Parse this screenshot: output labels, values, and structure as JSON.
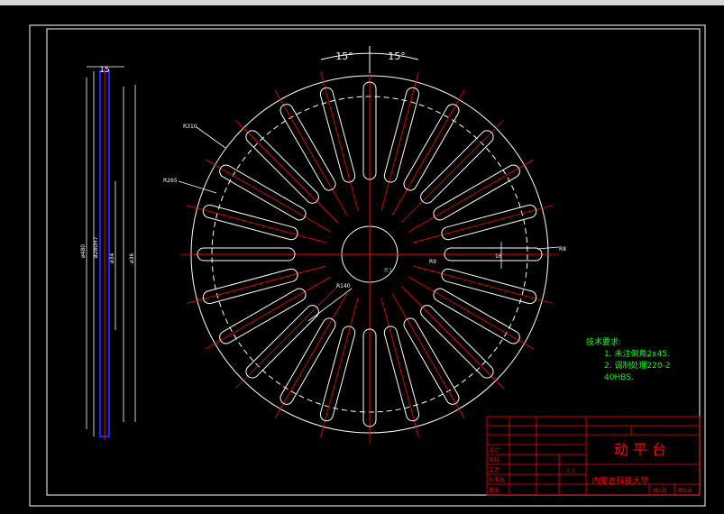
{
  "dimensions": {
    "top_angle_left": "15°",
    "top_angle_right": "15°",
    "side_thickness": "15",
    "r_outer": "R310",
    "r_ring": "R265",
    "r_inner": "R140",
    "r_hub": "R1",
    "r_slot_end": "R8",
    "r_slot": "R9",
    "slot_width": "16",
    "side_dim_1": "ø480",
    "side_dim_2": "ø280H7",
    "side_dim_3": "ø34",
    "side_dim_4": "ø36"
  },
  "note_mark": "",
  "notes": {
    "title": "技术要求:",
    "line1": "1. 未注倒角2x45.",
    "line2": "2. 调制处理220-2",
    "line3": "40HBS."
  },
  "title_block": {
    "part_name": "动 平 台",
    "university": "内蒙古科技大学",
    "scale": "1:2",
    "labels": [
      "设计",
      "审核",
      "工艺",
      "标准化",
      "批准",
      "日期"
    ],
    "sheet": "共1张",
    "sheet_no": "第1张"
  },
  "colors": {
    "background": "#000000",
    "line": "#ffffff",
    "center_line": "#ff0000",
    "dimension": "#ffffff",
    "note": "#00ff00",
    "frame": "#ffffff",
    "side_view": "#2020ff",
    "title_block": "#ff0000"
  }
}
